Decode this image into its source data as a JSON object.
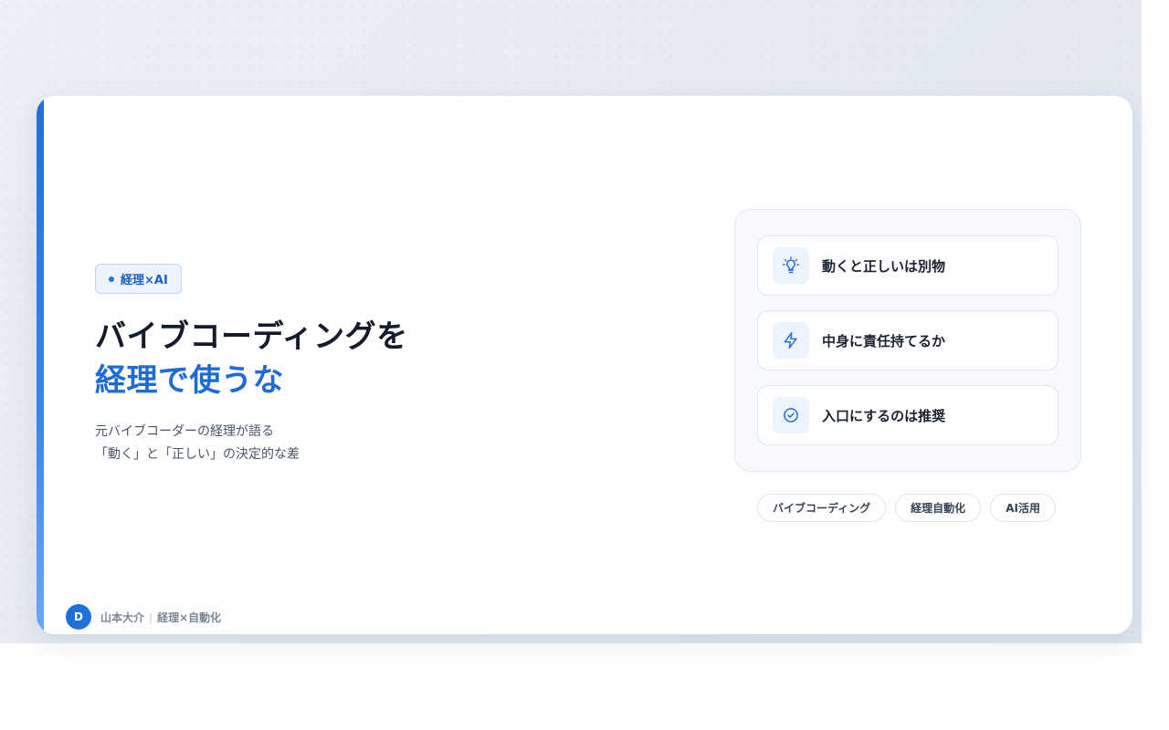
{
  "tag": {
    "label": "経理×AI"
  },
  "title": {
    "line1": "バイブコーディングを",
    "line2": "経理で使うな"
  },
  "subtitle": {
    "line1": "元バイブコーダーの経理が語る",
    "line2": "「動く」と「正しい」の決定的な差"
  },
  "points": [
    {
      "label": "動くと正しいは別物",
      "icon": "lightbulb-icon"
    },
    {
      "label": "中身に責任持てるか",
      "icon": "lightning-icon"
    },
    {
      "label": "入口にするのは推奨",
      "icon": "check-circle-icon"
    }
  ],
  "chips": [
    "バイブコーディング",
    "経理自動化",
    "AI活用"
  ],
  "footer": {
    "avatar_initial": "D",
    "author": "山本大介",
    "role": "経理×自動化"
  },
  "colors": {
    "accent": "#1f6fdc",
    "title_highlight": "#1e6bd6",
    "text_dark": "#141b2a"
  }
}
